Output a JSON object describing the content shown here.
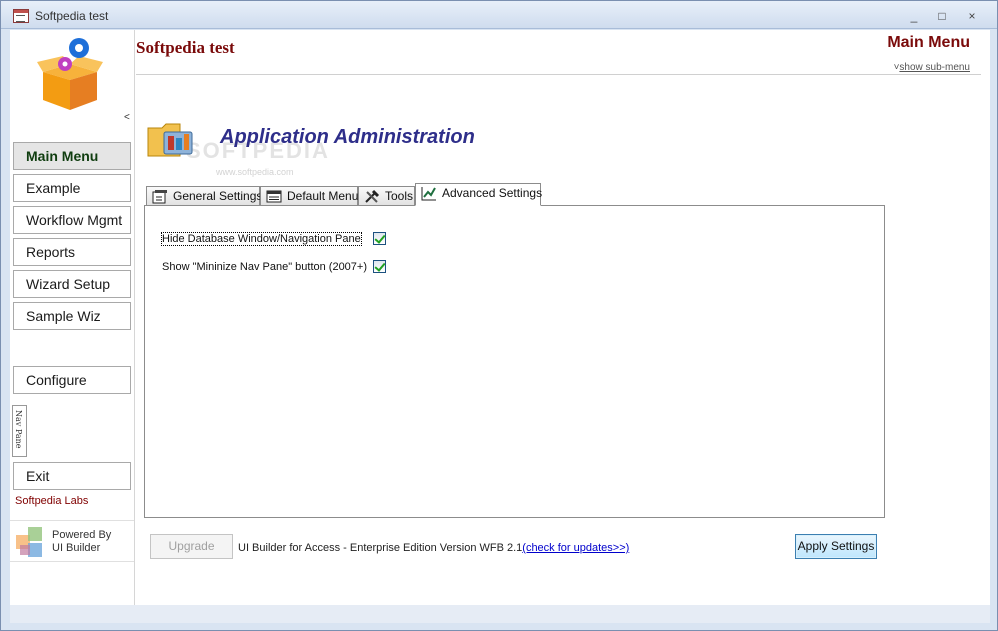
{
  "window": {
    "title": "Softpedia test",
    "minimize": "_",
    "maximize": "□",
    "close": "×"
  },
  "nav": {
    "collapse_glyph": "<",
    "items": [
      {
        "label": "Main Menu",
        "active": true
      },
      {
        "label": "Example"
      },
      {
        "label": "Workflow Mgmt"
      },
      {
        "label": "Reports"
      },
      {
        "label": "Wizard Setup"
      },
      {
        "label": "Sample Wiz"
      }
    ],
    "configure_label": "Configure",
    "nav_pane_label": "Nav Pane",
    "exit_label": "Exit",
    "company": "Softpedia Labs",
    "powered_by_line1": "Powered By",
    "powered_by_line2": "UI Builder"
  },
  "header": {
    "app_title": "Softpedia test",
    "menu_title": "Main Menu",
    "submenu_link": "show sub-menu"
  },
  "page": {
    "title": "Application Administration",
    "watermark": "SOFTPEDIA",
    "watermark_sub": "www.softpedia.com"
  },
  "tabs": [
    {
      "label": "General Settings"
    },
    {
      "label": "Default Menu"
    },
    {
      "label": "Tools"
    },
    {
      "label": "Advanced Settings",
      "active": true
    }
  ],
  "settings": [
    {
      "label": "Hide Database Window/Navigation Pane",
      "checked": true
    },
    {
      "label": "Show \"Mininize Nav Pane\" button (2007+)",
      "checked": true
    }
  ],
  "footer": {
    "upgrade_label": "Upgrade",
    "version_text": "UI Builder for Access - Enterprise Edition Version  WFB 2.1",
    "updates_link": "(check for updates>>)",
    "apply_label": "Apply Settings"
  },
  "colors": {
    "accent_red": "#7a0a0a",
    "title_blue": "#2e2e8a",
    "link_blue": "#0000cc"
  }
}
